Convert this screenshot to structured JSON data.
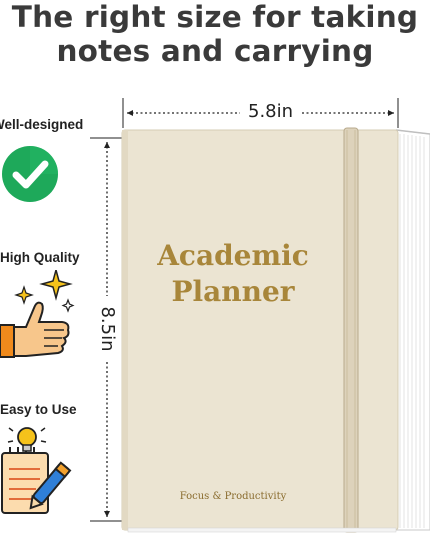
{
  "headline": {
    "line1": "The right size for taking",
    "line2": "notes and carrying"
  },
  "features": [
    {
      "label": "Well-designed",
      "icon": "checkmark-icon"
    },
    {
      "label": "High Quality",
      "icon": "thumbs-up-sparkle-icon"
    },
    {
      "label": "Easy to Use",
      "icon": "notepad-pen-lightbulb-icon"
    }
  ],
  "dimensions": {
    "width": "5.8in",
    "height": "8.5in"
  },
  "book": {
    "title_line1": "Academic",
    "title_line2": "Planner",
    "subtitle": "Focus & Productivity",
    "cover_color": "#ebe4d2",
    "band_color": "#ddd2bb",
    "title_color": "#a8863a"
  }
}
